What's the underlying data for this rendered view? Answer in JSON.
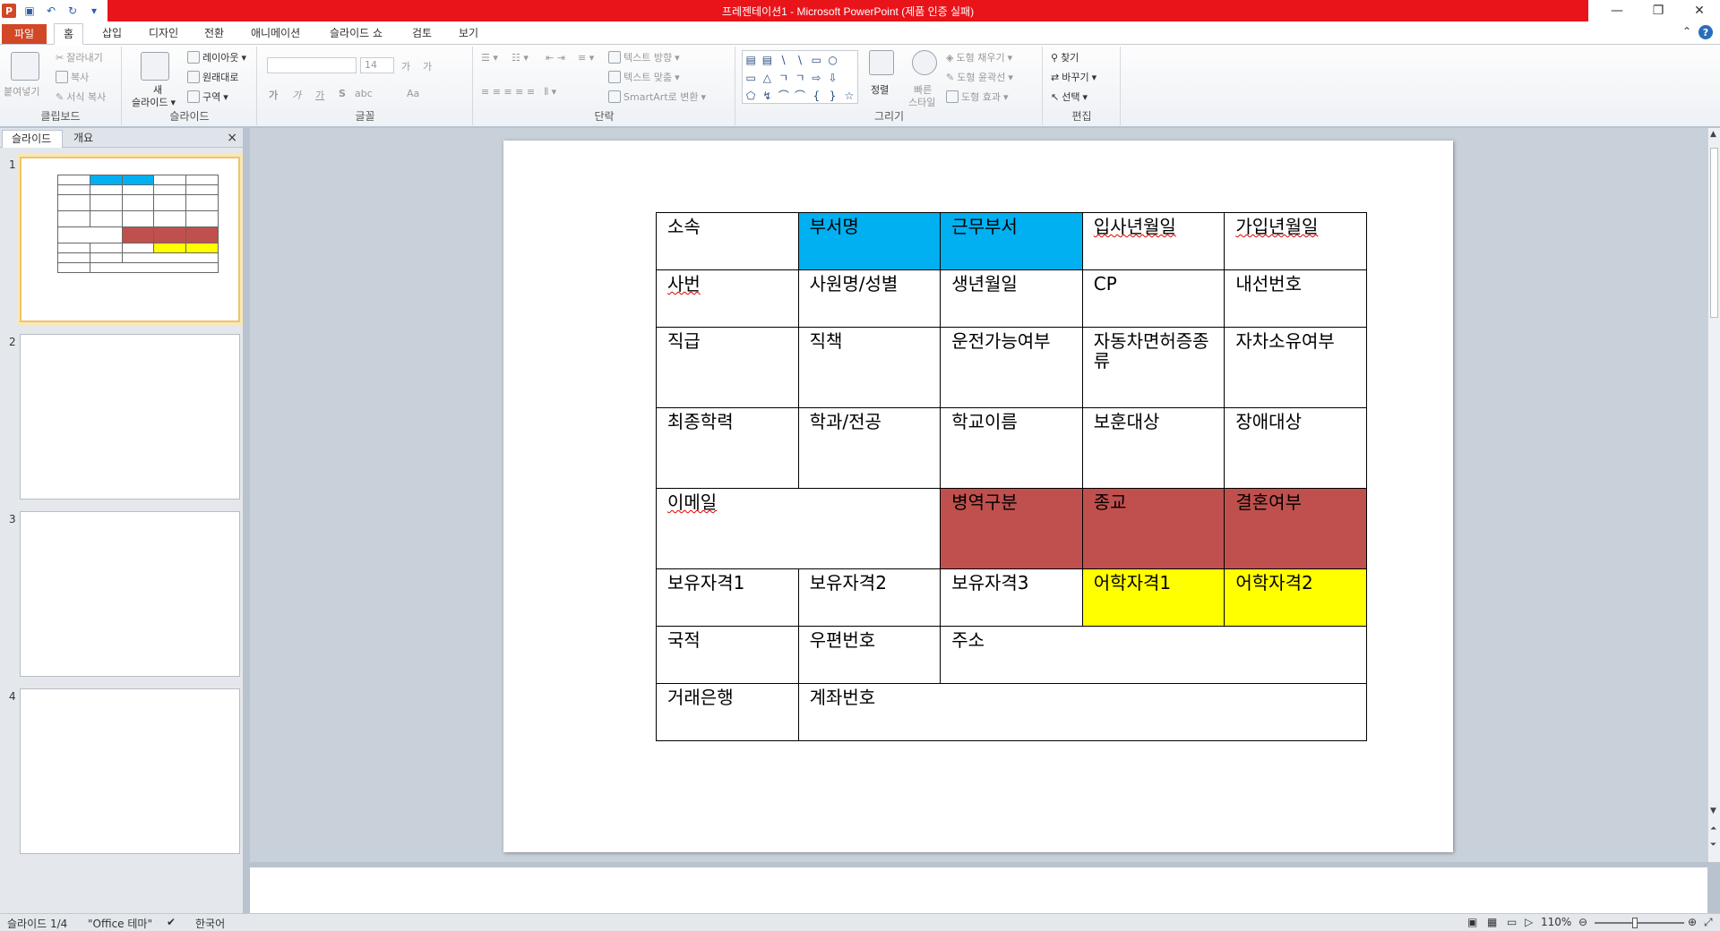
{
  "window": {
    "title": "프레젠테이션1 - Microsoft PowerPoint (제품 인증 실패)",
    "controls": [
      "minimize",
      "restore",
      "close"
    ]
  },
  "quick_access": {
    "app_icon": "P",
    "buttons": [
      "save-icon",
      "undo-icon",
      "redo-icon",
      "customize-icon"
    ]
  },
  "tabs": [
    {
      "label": "파일"
    },
    {
      "label": "홈"
    },
    {
      "label": "삽입"
    },
    {
      "label": "디자인"
    },
    {
      "label": "전환"
    },
    {
      "label": "애니메이션"
    },
    {
      "label": "슬라이드 쇼"
    },
    {
      "label": "검토"
    },
    {
      "label": "보기"
    }
  ],
  "ribbon": {
    "clipboard": {
      "label": "클립보드",
      "paste": "붙여넣기",
      "cut": "잘라내기",
      "copy": "복사",
      "format_painter": "서식 복사"
    },
    "slides": {
      "label": "슬라이드",
      "new_slide": "새\n슬라이드",
      "new_slide_1": "새",
      "new_slide_2": "슬라이드",
      "layout": "레이아웃",
      "reset": "원래대로",
      "section": "구역"
    },
    "font": {
      "label": "글꼴",
      "font_name": "",
      "font_size": "14",
      "bold": "가",
      "italic": "가",
      "underline": "가",
      "strike": "S",
      "spacing": "abc",
      "case": "Aa",
      "grow": "가",
      "shrink": "가"
    },
    "paragraph": {
      "label": "단락",
      "text_direction": "텍스트 방향",
      "align_text": "텍스트 맞춤",
      "smartart": "SmartArt로 변환"
    },
    "drawing": {
      "label": "그리기",
      "arrange": "정렬",
      "quick_styles_1": "빠른",
      "quick_styles_2": "스타일",
      "shape_fill": "도형 채우기",
      "shape_outline": "도형 윤곽선",
      "shape_effects": "도형 효과",
      "shapes": [
        "▤",
        "▤",
        "\\",
        "\\",
        "▭",
        "○",
        "",
        "▭",
        "△",
        "ㄱ",
        "ㄱ",
        "⇨",
        "⇩",
        "",
        "⬠",
        "↯",
        "⌒",
        "⌒",
        "{",
        "}",
        "☆"
      ]
    },
    "editing": {
      "label": "편집",
      "find": "찾기",
      "replace": "바꾸기",
      "select": "선택"
    }
  },
  "left_panel": {
    "tabs": [
      "슬라이드",
      "개요"
    ],
    "close": "×",
    "slide_numbers": [
      "1",
      "2",
      "3",
      "4"
    ]
  },
  "slide_table": {
    "rows": [
      [
        "소속",
        "부서명",
        "근무부서",
        "입사년월일",
        "가입년월일"
      ],
      [
        "사번",
        "사원명/성별",
        "생년월일",
        "CP",
        "내선번호"
      ],
      [
        "직급",
        "직책",
        "운전가능여부",
        "자동차면허증종류",
        "자차소유여부"
      ],
      [
        "최종학력",
        "학과/전공",
        "학교이름",
        "보훈대상",
        "장애대상"
      ],
      [
        "이메일",
        "병역구분",
        "종교",
        "결혼여부"
      ],
      [
        "보유자격1",
        "보유자격2",
        "보유자격3",
        "어학자격1",
        "어학자격2"
      ],
      [
        "국적",
        "우편번호",
        "주소"
      ],
      [
        "거래은행",
        "계좌번호"
      ]
    ],
    "colors": {
      "blue": "#00b0f0",
      "red": "#c0504d",
      "yellow": "#ffff00",
      "border": "#000000"
    }
  },
  "status": {
    "slide_info": "슬라이드 1/4",
    "theme": "\"Office 테마\"",
    "language": "한국어",
    "zoom": "110%"
  }
}
